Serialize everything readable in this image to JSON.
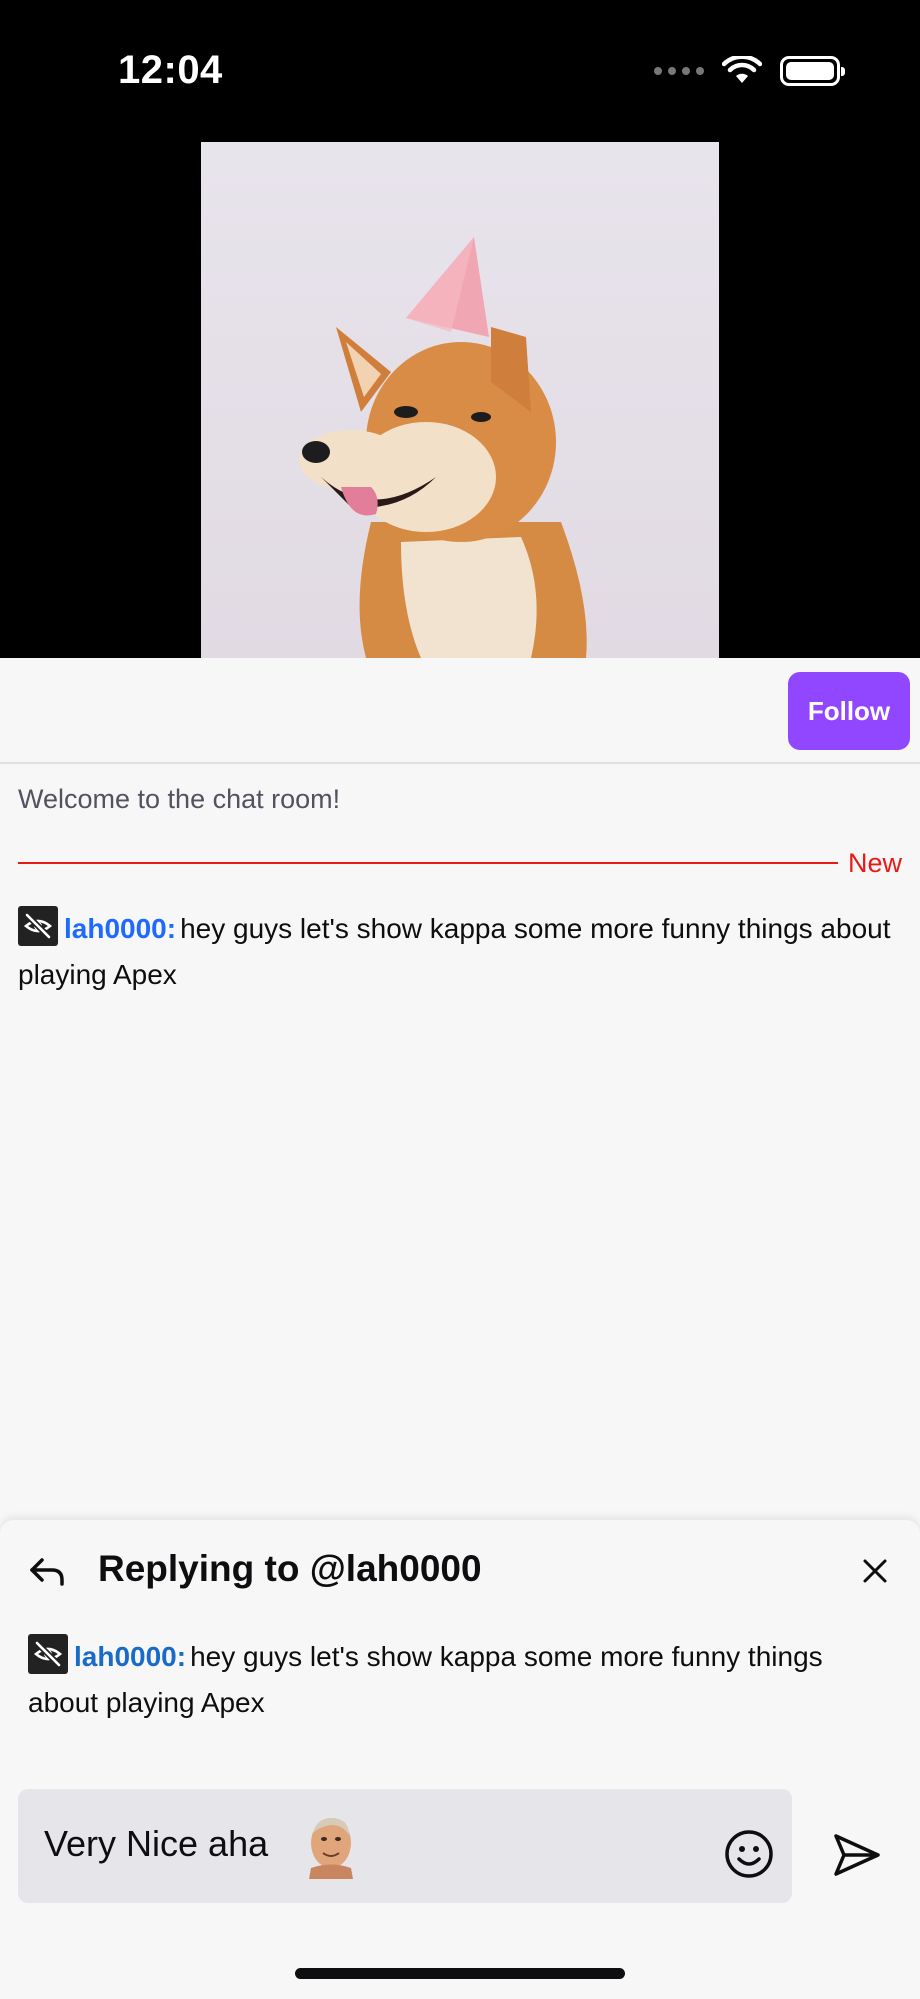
{
  "status_bar": {
    "time": "12:04"
  },
  "video": {
    "description_icon": "shiba-inu-party-hat-image"
  },
  "follow_button": {
    "label": "Follow",
    "color": "#9146ff"
  },
  "chat": {
    "welcome": "Welcome to the chat room!",
    "new_label": "New",
    "messages": [
      {
        "badge_icon": "hidden-eye-icon",
        "username": "lah0000:",
        "text": "hey guys let's show kappa some more funny things about playing Apex"
      }
    ]
  },
  "reply": {
    "title": "Replying to @lah0000",
    "quoted": {
      "badge_icon": "hidden-eye-icon",
      "username": "lah0000:",
      "text": "hey guys let's show kappa some more funny things about playing Apex"
    },
    "input_value": "Very Nice aha",
    "emote_icon": "kappa-emote-icon"
  },
  "colors": {
    "accent": "#9146ff",
    "username": "#1f69ff",
    "new_divider": "#e91916"
  }
}
